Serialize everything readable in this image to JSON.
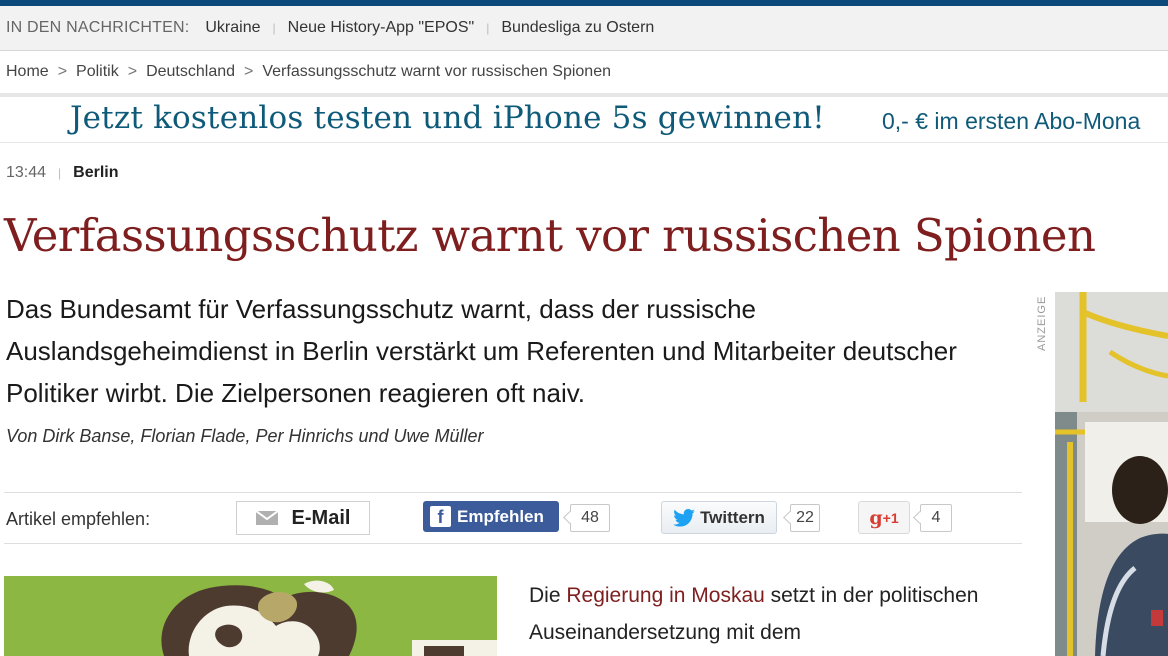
{
  "news_bar": {
    "label": "IN DEN NACHRICHTEN:",
    "items": [
      "Ukraine",
      "Neue History-App \"EPOS\"",
      "Bundesliga zu Ostern"
    ]
  },
  "breadcrumb": [
    "Home",
    "Politik",
    "Deutschland",
    "Verfassungsschutz warnt vor russischen Spionen"
  ],
  "banner_ad": {
    "headline": "Jetzt kostenlos testen und iPhone 5s gewinnen!",
    "subline": "0,- € im ersten Abo-Mona"
  },
  "article": {
    "time": "13:44",
    "location": "Berlin",
    "title": "Verfassungsschutz warnt vor russischen Spionen",
    "lead": "Das Bundesamt für Verfassungsschutz warnt, dass der russische Auslandsgeheimdienst in Berlin verstärkt um Referenten und Mitarbeiter deutscher Politiker wirbt. Die Zielpersonen reagieren oft naiv.",
    "authors": "Von Dirk Banse, Florian Flade, Per Hinrichs und Uwe Müller",
    "body": {
      "pre": "Die ",
      "link": "Regierung in Moskau",
      "post": " setzt in der politischen Auseinandersetzung mit dem"
    }
  },
  "share": {
    "label": "Artikel empfehlen:",
    "email": "E-Mail",
    "facebook": "Empfehlen",
    "facebook_count": "48",
    "twitter": "Twittern",
    "twitter_count": "22",
    "gplus_g": "g",
    "gplus_plus": "+1",
    "gplus_count": "4"
  },
  "side": {
    "anzeige": "ANZEIGE"
  },
  "colors": {
    "title": "#7e1e1e",
    "link": "#7e1e1e",
    "ad_text": "#0f5a79",
    "facebook": "#3b5b9b",
    "twitter": "#1da1f2",
    "gplus": "#d73d32"
  },
  "icons": [
    "mail-icon",
    "facebook-icon",
    "twitter-bird-icon"
  ]
}
